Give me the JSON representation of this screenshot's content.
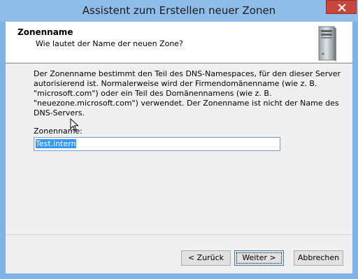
{
  "window": {
    "title": "Assistent zum Erstellen neuer Zonen",
    "close_icon": "close-icon"
  },
  "header": {
    "title": "Zonenname",
    "subtitle": "Wie lautet der Name der neuen Zone?",
    "icon": "server-icon"
  },
  "body": {
    "description": "Der Zonenname bestimmt den Teil des DNS-Namespaces, für den dieser Server autorisierend ist. Normalerweise wird der Firmendomänenname (wie z. B. \"microsoft.com\") oder ein Teil des Domänennamens (wie z. B. \"neuezone.microsoft.com\") verwendet. Der Zonenname ist nicht der Name des DNS-Servers.",
    "field_label": "Zonenname:",
    "field_value": "Test.intern"
  },
  "buttons": {
    "back": "< Zurück",
    "next": "Weiter >",
    "cancel": "Abbrechen"
  }
}
